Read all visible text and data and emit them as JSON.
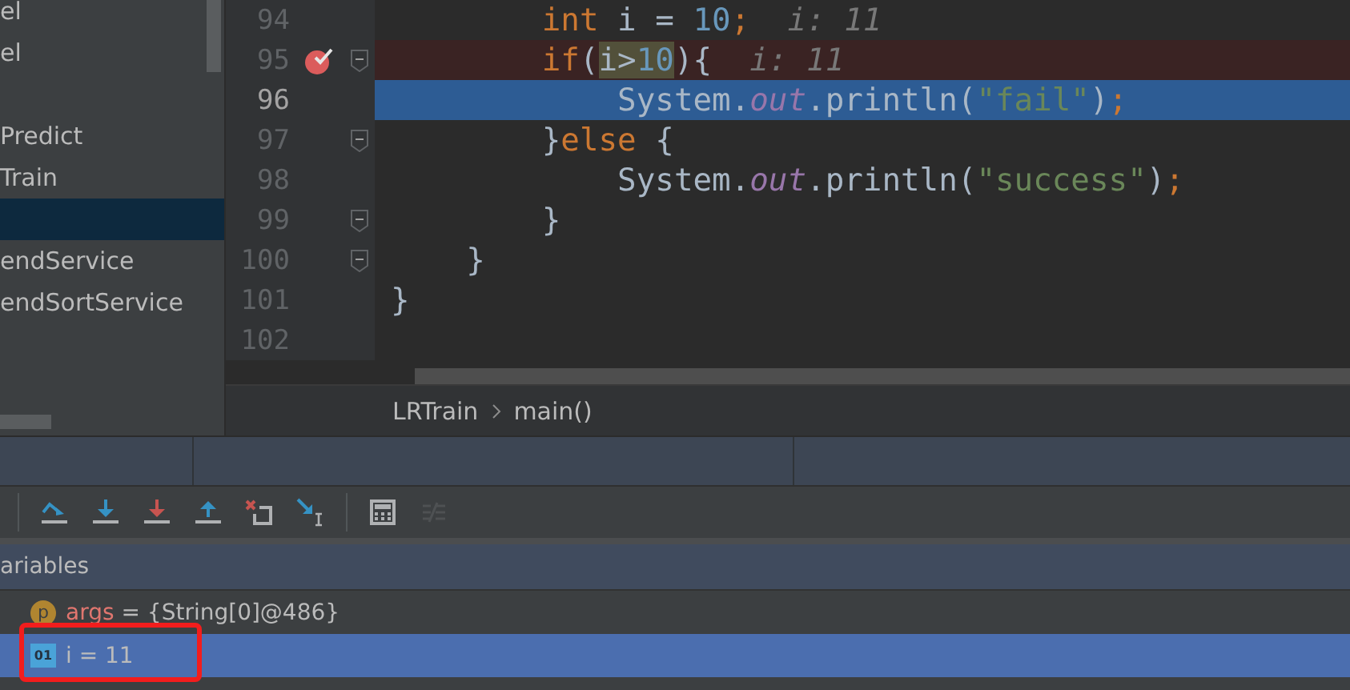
{
  "project_tree": {
    "items": [
      {
        "label": "el",
        "selected": false
      },
      {
        "label": "el",
        "selected": false
      },
      {
        "selected": false
      },
      {
        "label": "Predict",
        "selected": false
      },
      {
        "label": "Train",
        "selected": false
      },
      {
        "selected": true
      },
      {
        "label": "endService",
        "selected": false
      },
      {
        "label": "endSortService",
        "selected": false
      }
    ]
  },
  "editor": {
    "lines": [
      {
        "number": "94",
        "current": false,
        "breakpoint": false,
        "fold": false,
        "tokens": [
          {
            "kind": "keyword",
            "text": "        int"
          },
          {
            "kind": "plain",
            "text": " i = "
          },
          {
            "kind": "number",
            "text": "10"
          },
          {
            "kind": "keyword",
            "text": ";"
          },
          {
            "kind": "hint",
            "text": "  i: 11"
          }
        ]
      },
      {
        "number": "95",
        "current": false,
        "breakpoint": true,
        "fold": true,
        "tokens": [
          {
            "kind": "keyword",
            "text": "        if"
          },
          {
            "kind": "plain",
            "text": "("
          },
          {
            "kind": "highlight",
            "tokens": [
              {
                "kind": "plain",
                "text": "i>"
              },
              {
                "kind": "number",
                "text": "10"
              }
            ]
          },
          {
            "kind": "plain",
            "text": "){"
          },
          {
            "kind": "hint",
            "text": "  i: 11"
          }
        ]
      },
      {
        "number": "96",
        "current": true,
        "breakpoint": false,
        "fold": false,
        "tokens": [
          {
            "kind": "plain",
            "text": "            System."
          },
          {
            "kind": "field",
            "text": "out"
          },
          {
            "kind": "plain",
            "text": ".println("
          },
          {
            "kind": "string",
            "text": "\"fail\""
          },
          {
            "kind": "plain",
            "text": ")"
          },
          {
            "kind": "keyword",
            "text": ";"
          }
        ]
      },
      {
        "number": "97",
        "current": false,
        "breakpoint": false,
        "fold": true,
        "tokens": [
          {
            "kind": "plain",
            "text": "        }"
          },
          {
            "kind": "keyword",
            "text": "else"
          },
          {
            "kind": "plain",
            "text": " {"
          }
        ]
      },
      {
        "number": "98",
        "current": false,
        "breakpoint": false,
        "fold": false,
        "tokens": [
          {
            "kind": "plain",
            "text": "            System."
          },
          {
            "kind": "field",
            "text": "out"
          },
          {
            "kind": "plain",
            "text": ".println("
          },
          {
            "kind": "string",
            "text": "\"success\""
          },
          {
            "kind": "plain",
            "text": ")"
          },
          {
            "kind": "keyword",
            "text": ";"
          }
        ]
      },
      {
        "number": "99",
        "current": false,
        "breakpoint": false,
        "fold": true,
        "tokens": [
          {
            "kind": "plain",
            "text": "        }"
          }
        ]
      },
      {
        "number": "100",
        "current": false,
        "breakpoint": false,
        "fold": true,
        "tokens": [
          {
            "kind": "plain",
            "text": "    }"
          }
        ]
      },
      {
        "number": "101",
        "current": false,
        "breakpoint": false,
        "fold": false,
        "tokens": [
          {
            "kind": "plain",
            "text": "}"
          }
        ]
      },
      {
        "number": "102",
        "current": false,
        "breakpoint": false,
        "fold": false
      }
    ]
  },
  "breadcrumb": [
    "LRTrain",
    "main()"
  ],
  "debug_toolbar": [
    {
      "kind": "step-over",
      "disabled": false
    },
    {
      "kind": "step-into",
      "disabled": false
    },
    {
      "kind": "force-step-into",
      "disabled": false
    },
    {
      "kind": "step-out",
      "disabled": false
    },
    {
      "kind": "drop-frame",
      "disabled": false
    },
    {
      "kind": "run-to-cursor",
      "disabled": false
    },
    {
      "kind": "separator"
    },
    {
      "kind": "evaluate",
      "disabled": false
    },
    {
      "kind": "trace",
      "disabled": true
    }
  ],
  "variables": {
    "title": "ariables",
    "rows": [
      {
        "kind": "param",
        "badge": "p",
        "name": "args",
        "operator": "=",
        "value": "{String[0]@486}",
        "selected": false,
        "annotated": false
      },
      {
        "kind": "field",
        "badge": "01",
        "name": "i",
        "operator": "=",
        "value": "11",
        "selected": true,
        "annotated": true
      }
    ]
  }
}
